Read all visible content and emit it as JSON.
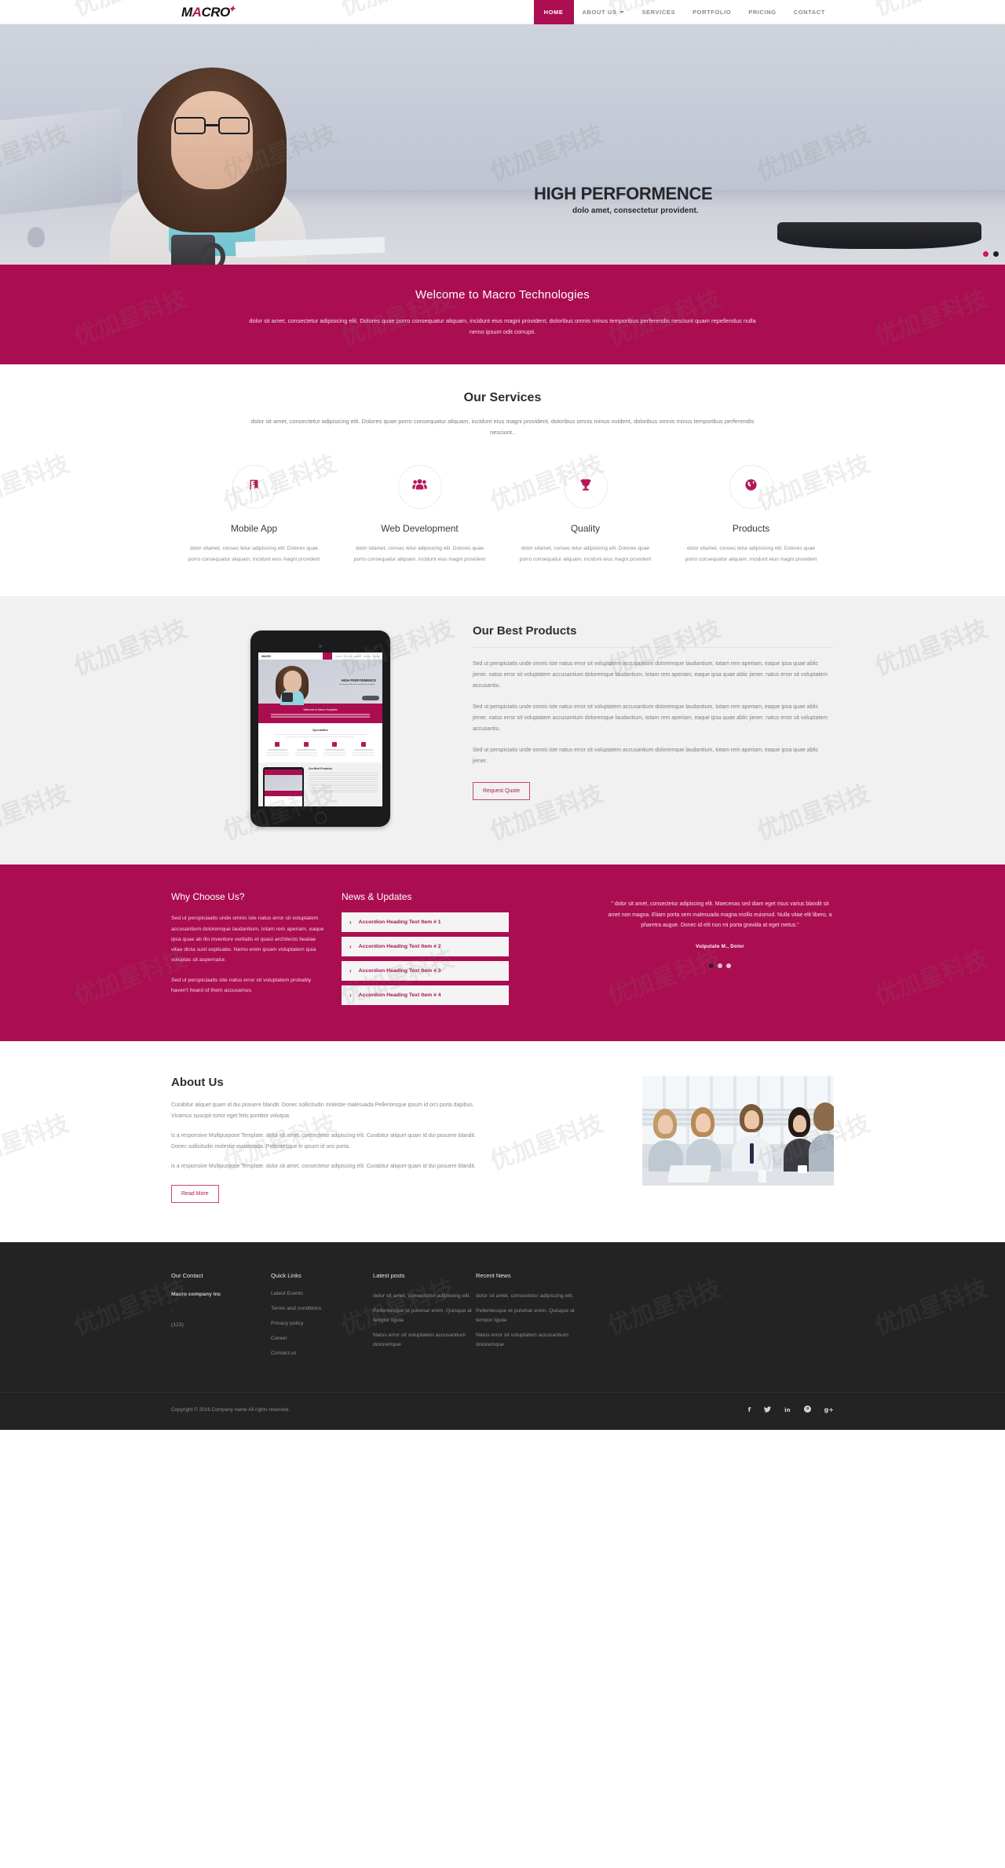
{
  "brand": {
    "logo_main": "M",
    "logo_a": "A",
    "logo_rest": "CRO",
    "logo_star": "✦",
    "accent": "#ab0e50",
    "accent_dark": "#a5154f"
  },
  "nav": {
    "items": [
      {
        "label": "HOME",
        "active": true
      },
      {
        "label": "ABOUT US",
        "active": false,
        "caret": true
      },
      {
        "label": "SERVICES",
        "active": false
      },
      {
        "label": "PORTFOLIO",
        "active": false
      },
      {
        "label": "PRICING",
        "active": false
      },
      {
        "label": "CONTACT",
        "active": false
      }
    ]
  },
  "hero": {
    "title": "HIGH PERFORMENCE",
    "subtitle": "dolo amet, consectetur provident.",
    "slide_count": 2,
    "active_slide": 1
  },
  "welcome": {
    "heading": "Welcome to Macro Technologies",
    "body": "dolor sit amet, consectetur adipisicing elit. Dolores quae porro consequatur aliquam, incidunt eius magni provident, doloribus omnis minus temporibus perferendis nesciunt quam repellendus nulla nemo ipsum odit corrupti."
  },
  "services": {
    "heading": "Our Services",
    "lead": "dolor sit amet, consectetur adipisicing elit. Dolores quae porro consequatur aliquam, incidunt eius magni provident, doloribus omnis minus ovident, doloribus omnis minus temporibus perferendis nesciunt..",
    "items": [
      {
        "icon": "book-icon",
        "title": "Mobile App",
        "text": "dolor sitamet, consec tetur adipisicing elit. Dolores quae porro consequatur aliquam, incidunt eius magni provident"
      },
      {
        "icon": "users-group-icon",
        "title": "Web Development",
        "text": "dolor sitamet, consec tetur adipisicing elit. Dolores quae porro consequatur aliquam, incidunt eius magni provident"
      },
      {
        "icon": "trophy-icon",
        "title": "Quality",
        "text": "dolor sitamet, consec tetur adipisicing elit. Dolores quae porro consequatur aliquam, incidunt eius magni provident"
      },
      {
        "icon": "globe-icon",
        "title": "Products",
        "text": "dolor sitamet, consec tetur adipisicing elit. Dolores quae porro consequatur aliquam, incidunt eius magni provident"
      }
    ]
  },
  "best_products": {
    "heading": "Our Best Products",
    "paragraphs": [
      "Sed ut perspiciatis unde omnis iste natus error sit voluptatem accusantium doloremque laudantium, totam rem aperiam, eaque ipsa quae ablic jiener. natus error sit voluptatem accusantium doloremque laudantium, totam rem aperiam, eaque ipsa quae ablic jiener. natus error sit voluptatem accusantiu.",
      "Sed ut perspiciatis unde omnis iste natus error sit voluptatem accusantium doloremque laudantium, totam rem aperiam, eaque ipsa quae ablic jiener. natus error sit voluptatem accusantium doloremque laudantium, totam rem aperiam, eaque ipsa quae ablic jiener. natus error sit voluptatem accusantiu.",
      "Sed ut perspiciatis unde omnis iste natus error sit voluptatem accusantium doloremque laudantium, totam rem aperiam, eaque ipsa quae ablic jiener."
    ],
    "button": "Request Quote",
    "tablet_mockup": {
      "logo": "MACRO",
      "hero_title": "HIGH PERFORMENCE",
      "hero_sub": "Lorem ipsum dolo amet, consectetur provident",
      "welcome": "Welcome to Macro Hospitals",
      "services_title": "Specialities",
      "best_title": "Our Best Products"
    }
  },
  "why": {
    "heading": "Why Choose Us?",
    "paragraphs": [
      "Sed ut perspiciaatis unde omnis iste natus error sit voluptatem accusantium doloremque laudantium, totam rem aperiam, eaque ipsa quae ab illo inventore veritatis et quasi architecto beatae vitae dicta sunt explicabo. Nemo enim ipsam voluptatem quia voluptas sit aspernatur.",
      "Sed ut perspiciaatis iste natus error sit voluptatem probably haven't heard of them accusamus."
    ]
  },
  "news": {
    "heading": "News & Updates",
    "items": [
      {
        "chevron": "›",
        "label": "Accordion Heading Text Item # 1"
      },
      {
        "chevron": "›",
        "label": "Accordion Heading Text Item # 2"
      },
      {
        "chevron": "›",
        "label": "Accordion Heading Text Item # 3"
      },
      {
        "chevron": "›",
        "label": "Accordion Heading Text Item # 4"
      }
    ]
  },
  "testimonial": {
    "quote": "\" dolor sit amet, consectetur adipiscing elit. Maecenas sed diam eget risus varius blandit sit amet non magna. Etiam porta sem malesuada magna mollis euismod. Nulla vitae elit libero, a pharetra augue. Donec id elit non mi porta gravida at eget metus.\"",
    "author": "Vulputate M., Dolor",
    "slide_count": 3,
    "active_slide": 1
  },
  "about": {
    "heading": "About Us",
    "paragraphs": [
      "Curabitur aliquet quam id dui posuere blandit. Donec sollicitudin molestie malesuada Pellentesque\nipsum id orci porta dapibus. Vivamus suscipit tortor eget felis porttitor volutpat.",
      "is a responsive Multipurpose Template. dolor sit amet, consectetur adipiscing elit. Curabitur aliquet quam id dui posuere blandit. Donec sollicitudin molestie malesuada. Pellentesque in ipsum id orci porta.",
      "is a responsive Multipurpose Template. dolor sit amet, consectetur adipiscing elit. Curabitur aliquet quam id dui posuere blandit."
    ],
    "button": "Read More",
    "image_alt": "business-team-meeting-photo"
  },
  "footer": {
    "columns": [
      {
        "title": "Our Contact",
        "company": "Macro company Inc",
        "lines": [
          ".",
          "(123)"
        ]
      },
      {
        "title": "Quick Links",
        "links": [
          "Latest Events",
          "Terms and conditions",
          "Privacy policy",
          "Career",
          "Contact us"
        ]
      },
      {
        "title": "Latest posts",
        "posts": [
          "dolor sit amet, consectetur adipiscing elit.",
          "Pellentesque et pulvinar enim. Quisque at tempor ligula",
          "Natus error sit voluptatem accusantium doloremque"
        ]
      },
      {
        "title": "Recent News",
        "posts": [
          "dolor sit amet, consectetur adipiscing elit.",
          "Pellentesque et pulvinar enim. Quisque at tempor ligula",
          "Natus error sit voluptatem accusantium doloremque"
        ]
      }
    ],
    "copyright": "Copyright © 2016.Company name All rights reserved.",
    "socials": [
      {
        "name": "facebook-icon",
        "glyph": "f"
      },
      {
        "name": "twitter-icon",
        "glyph": "🐦"
      },
      {
        "name": "linkedin-icon",
        "glyph": "in"
      },
      {
        "name": "pinterest-icon",
        "glyph": "℗"
      },
      {
        "name": "googleplus-icon",
        "glyph": "g+"
      }
    ]
  },
  "watermark": {
    "text": "优加星科技"
  }
}
